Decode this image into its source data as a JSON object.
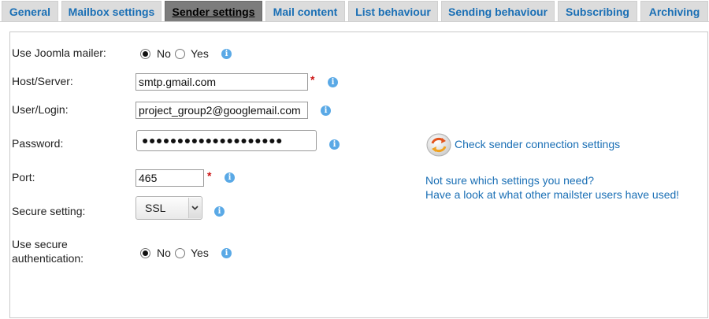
{
  "tabs": [
    {
      "label": "General",
      "active": false
    },
    {
      "label": "Mailbox settings",
      "active": false
    },
    {
      "label": "Sender settings",
      "active": true
    },
    {
      "label": "Mail content",
      "active": false
    },
    {
      "label": "List behaviour",
      "active": false
    },
    {
      "label": "Sending behaviour",
      "active": false
    },
    {
      "label": "Subscribing",
      "active": false
    },
    {
      "label": "Archiving",
      "active": false
    }
  ],
  "form": {
    "joomla_mailer": {
      "label": "Use Joomla mailer:",
      "options": [
        "No",
        "Yes"
      ],
      "selected": "No"
    },
    "host": {
      "label": "Host/Server:",
      "value": "smtp.gmail.com",
      "required": "*"
    },
    "user": {
      "label": "User/Login:",
      "value": "project_group2@googlemail.com"
    },
    "password": {
      "label": "Password:",
      "value": "●●●●●●●●●●●●●●●●●●●●"
    },
    "port": {
      "label": "Port:",
      "value": "465",
      "required": "*"
    },
    "secure": {
      "label": "Secure setting:",
      "value": "SSL"
    },
    "secure_auth": {
      "label_line1": "Use secure",
      "label_line2": "authentication:",
      "options": [
        "No",
        "Yes"
      ],
      "selected": "No"
    }
  },
  "sidebar": {
    "check_link": "Check sender connection settings",
    "help_line1": "Not sure which settings you need?",
    "help_line2": "Have a look at what other mailster users have used!"
  },
  "colors": {
    "link": "#1a6fb5",
    "tab_bg": "#dcdcdc",
    "tab_active_bg": "#7c7c7c",
    "required": "#cc1111",
    "info": "#5aa9e6"
  }
}
